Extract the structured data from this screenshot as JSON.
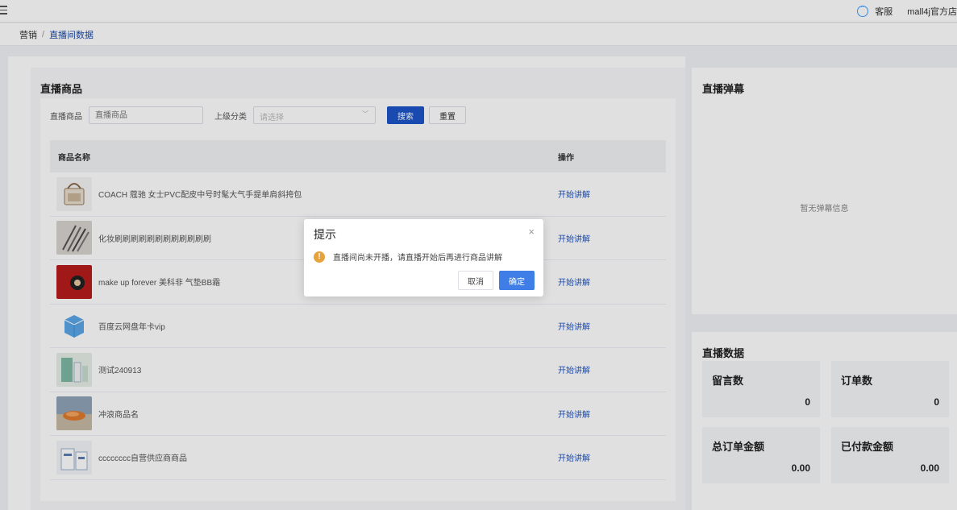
{
  "topbar": {
    "customer_service": "客服",
    "shop_name": "mall4j官方店"
  },
  "breadcrumb": {
    "parent": "营销",
    "separator": "/",
    "current": "直播间数据"
  },
  "products": {
    "title": "直播商品",
    "filter": {
      "product_label": "直播商品",
      "product_placeholder": "直播商品",
      "category_label": "上级分类",
      "category_placeholder": "请选择",
      "search_button": "搜索",
      "reset_button": "重置"
    },
    "columns": {
      "name": "商品名称",
      "action": "操作"
    },
    "rows": [
      {
        "name": "COACH 蔻驰 女士PVC配皮中号时髦大气手提单肩斜挎包",
        "action": "开始讲解",
        "thumb": "bag"
      },
      {
        "name": "化妆刷刷刷刷刷刷刷刷刷刷刷刷",
        "action": "开始讲解",
        "thumb": "brushes"
      },
      {
        "name": "make up forever 美科非 气垫BB霜",
        "action": "开始讲解",
        "thumb": "cushion"
      },
      {
        "name": "百度云网盘年卡vip",
        "action": "开始讲解",
        "thumb": "cloud"
      },
      {
        "name": "测试240913",
        "action": "开始讲解",
        "thumb": "test"
      },
      {
        "name": "冲浪商品名",
        "action": "开始讲解",
        "thumb": "food"
      },
      {
        "name": "cccccccc自营供应商商品",
        "action": "开始讲解",
        "thumb": "box"
      }
    ]
  },
  "danmaku": {
    "title": "直播弹幕",
    "empty": "暂无弹幕信息"
  },
  "stats": {
    "title": "直播数据",
    "comments_label": "留言数",
    "comments_value": "0",
    "orders_label": "订单数",
    "orders_value": "0",
    "total_amount_label": "总订单金额",
    "total_amount_value": "0.00",
    "paid_amount_label": "已付款金额",
    "paid_amount_value": "0.00"
  },
  "dialog": {
    "title": "提示",
    "close": "×",
    "message": "直播间尚未开播，请直播开始后再进行商品讲解",
    "cancel": "取消",
    "confirm": "确定"
  },
  "colors": {
    "primary": "#1d55c8",
    "dialog_confirm": "#3f7ee6",
    "warning": "#e6a23c"
  }
}
